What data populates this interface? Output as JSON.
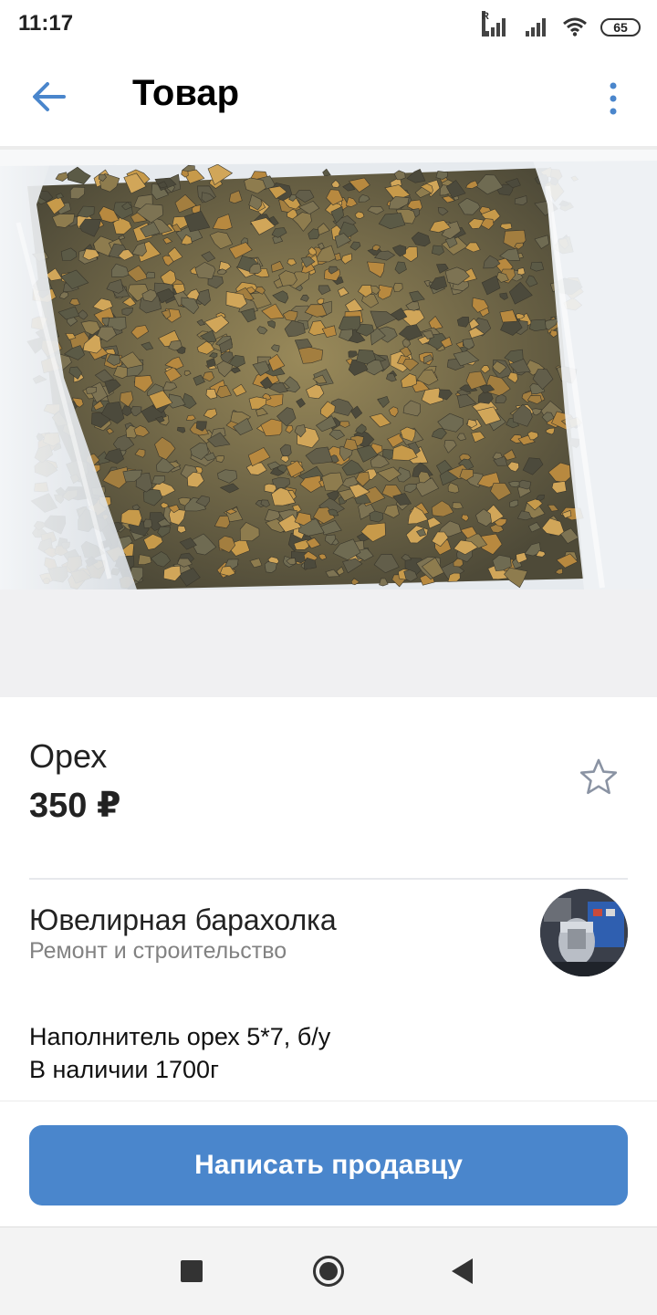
{
  "status_bar": {
    "time": "11:17",
    "signal_label": "R",
    "battery": "65"
  },
  "header": {
    "title": "Товар",
    "back_icon": "arrow-left-icon",
    "menu_icon": "more-vertical-icon",
    "accent_color": "#4a86cc"
  },
  "product": {
    "name": "Орех",
    "price": "350 ₽",
    "favorite_icon": "star-outline-icon"
  },
  "community": {
    "name": "Ювелирная барахолка",
    "category": "Ремонт и строительство"
  },
  "description": {
    "lines": [
      "Наполнитель орех 5*7, б/у",
      "В наличии 1700г"
    ]
  },
  "actions": {
    "message_seller": "Написать продавцу",
    "button_color": "#4a86cc"
  },
  "nav_bar": {
    "icons": [
      "recents-square-icon",
      "home-circle-icon",
      "back-triangle-icon"
    ]
  }
}
